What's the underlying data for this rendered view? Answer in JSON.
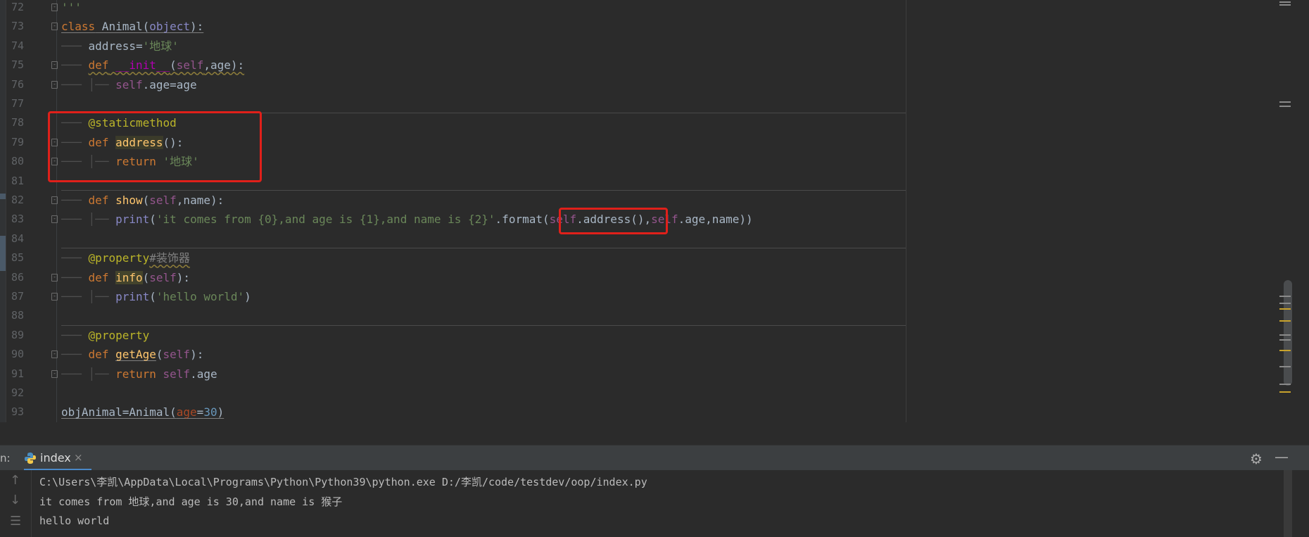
{
  "editor": {
    "lines": [
      {
        "n": "72",
        "html": "<span class='guide'></span><span class='str'>'''</span>"
      },
      {
        "n": "73",
        "html": "<span class='kw underl'>class</span><span class='underl'> Animal(</span><span class='obj underl'>object</span><span class='underl'>):</span>"
      },
      {
        "n": "74",
        "html": "<span class='guide'>───</span> address=<span class='str'>'地球'</span>"
      },
      {
        "n": "75",
        "html": "<span class='guide'>───</span> <span class='kw warn'>def</span><span class='warn'> </span><span class='magic warn'>__init__</span><span class='warn'>(</span><span class='self warn'>self</span><span class='warn'>,age):</span>"
      },
      {
        "n": "76",
        "html": "<span class='guide'>───</span> <span class='guide'>│──</span> <span class='self'>self</span>.age=age"
      },
      {
        "n": "77",
        "html": ""
      },
      {
        "n": "78",
        "html": "<span class='guide'>───</span> <span class='deco'>@staticmethod</span>"
      },
      {
        "n": "79",
        "html": "<span class='guide'>───</span> <span class='kw'>def</span> <span class='hl'>address</span>():"
      },
      {
        "n": "80",
        "html": "<span class='guide'>───</span> <span class='guide'>│──</span> <span class='kw'>return</span> <span class='str'>'地球'</span>"
      },
      {
        "n": "81",
        "html": ""
      },
      {
        "n": "82",
        "html": "<span class='guide'>───</span> <span class='kw'>def</span> <span class='fn'>show</span>(<span class='self'>self</span>,name):"
      },
      {
        "n": "83",
        "html": "<span class='guide'>───</span> <span class='guide'>│──</span> <span class='obj'>print</span>(<span class='str'>'it comes from {0},and age is {1},and name is {2}'</span>.format(<span class='self'>self</span>.address(),<span class='self'>self</span>.age,name))"
      },
      {
        "n": "84",
        "html": ""
      },
      {
        "n": "85",
        "html": "<span class='guide'>───</span> <span class='deco'>@property</span><span class='cmt warn'>#装饰器</span>"
      },
      {
        "n": "86",
        "html": "<span class='guide'>───</span> <span class='kw'>def</span> <span class='hl2'>info</span>(<span class='self'>self</span>):"
      },
      {
        "n": "87",
        "html": "<span class='guide'>───</span> <span class='guide'>│──</span> <span class='obj'>print</span>(<span class='str'>'hello world'</span>)"
      },
      {
        "n": "88",
        "html": ""
      },
      {
        "n": "89",
        "html": "<span class='guide'>───</span> <span class='deco'>@property</span>"
      },
      {
        "n": "90",
        "html": "<span class='guide'>───</span> <span class='kw'>def</span> <span class='fn underl'>getAge</span>(<span class='self'>self</span>):"
      },
      {
        "n": "91",
        "html": "<span class='guide'>───</span> <span class='guide'>│──</span> <span class='kw'>return</span> <span class='self'>self</span>.age"
      },
      {
        "n": "92",
        "html": ""
      },
      {
        "n": "93",
        "html": "<span class='underl'>objAnimal=Animal(</span><span class='param underl'>age</span><span class='underl'>=</span><span class='num underl'>30</span><span class='underl'>)</span>"
      }
    ]
  },
  "run_panel": {
    "label": "n:",
    "tab_name": "index",
    "tab_close": "×"
  },
  "console": {
    "lines": [
      "C:\\Users\\李凯\\AppData\\Local\\Programs\\Python\\Python39\\python.exe D:/李凯/code/testdev/oop/index.py",
      "it comes from 地球,and age is 30,and name is 猴子",
      "hello world"
    ]
  },
  "colors": {
    "background": "#2b2b2b",
    "highlight_box": "#e0201a",
    "keyword": "#cc7832",
    "string": "#6a8759"
  }
}
